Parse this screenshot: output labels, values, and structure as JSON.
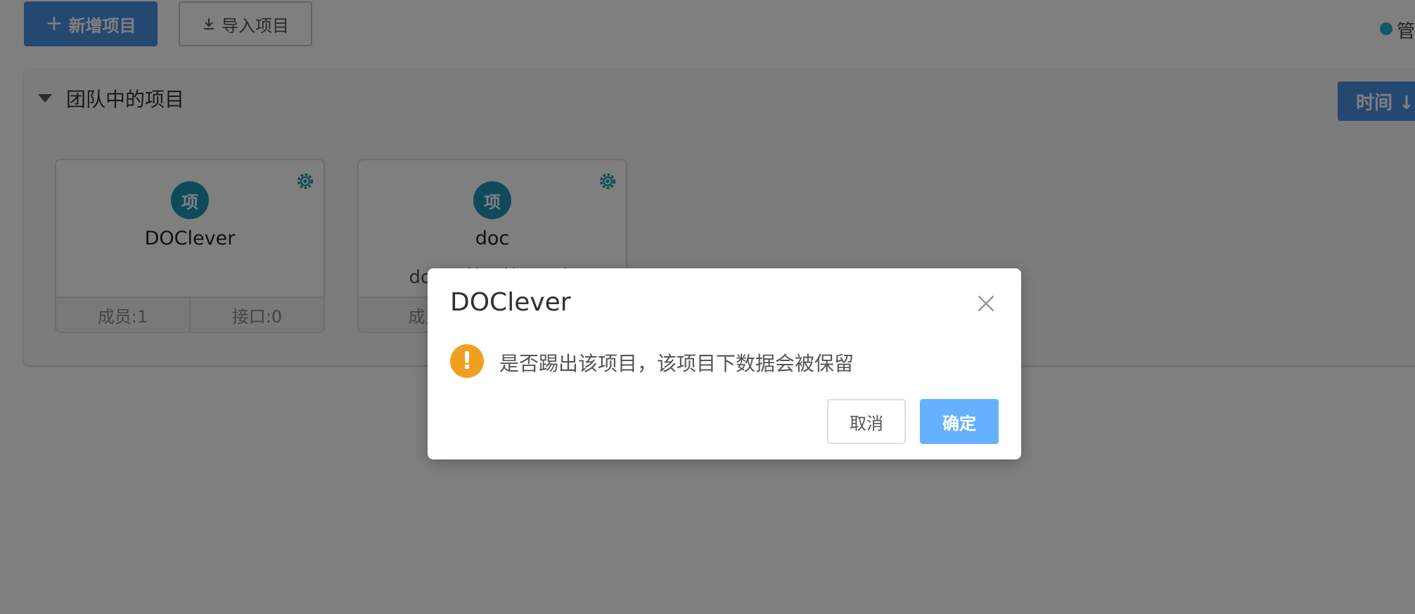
{
  "toolbar": {
    "add_label": "新增项目",
    "import_label": "导入项目",
    "legend_label": "管"
  },
  "panel": {
    "title": "团队中的项目",
    "sort_label": "时间 ↓"
  },
  "projects": [
    {
      "badge": "项",
      "name": "DOClever",
      "description": "",
      "members": "成员:1",
      "interfaces": "接口:0"
    },
    {
      "badge": "项",
      "name": "doc",
      "description": "doc… 接口管理平台",
      "members": "成员",
      "interfaces": ""
    }
  ],
  "dialog": {
    "title": "DOClever",
    "message": "是否踢出该项目，该项目下数据会被保留",
    "cancel_label": "取消",
    "confirm_label": "确定"
  },
  "colors": {
    "primary": "#4a90e2",
    "badge": "#1f95b7",
    "warning": "#f0a020",
    "confirm_disabled": "#66b1ff"
  },
  "icons": [
    "plus-icon",
    "download-icon",
    "caret-down-icon",
    "gear-icon",
    "close-icon",
    "warning-icon"
  ]
}
